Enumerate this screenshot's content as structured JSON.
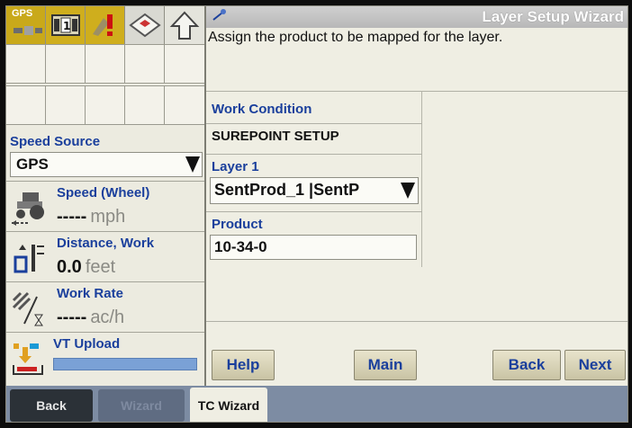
{
  "status_icons": {
    "gps_label": "GPS",
    "channel_number": "1"
  },
  "left_panel": {
    "speed_source_label": "Speed Source",
    "speed_source_value": "GPS",
    "speed": {
      "label": "Speed (Wheel)",
      "value": "-----",
      "unit": "mph"
    },
    "distance": {
      "label": "Distance, Work",
      "value": "0.0",
      "unit": "feet"
    },
    "work_rate": {
      "label": "Work Rate",
      "value": "-----",
      "unit": "ac/h"
    },
    "vt_upload": {
      "label": "VT Upload"
    }
  },
  "wizard": {
    "title": "Layer Setup Wizard",
    "instruction": "Assign the product to be mapped for the layer.",
    "work_condition_label": "Work Condition",
    "work_condition_value": "SUREPOINT SETUP",
    "layer_label": "Layer 1",
    "layer_value": "SentProd_1 |SentP",
    "product_label": "Product",
    "product_value": "10-34-0",
    "buttons": {
      "help": "Help",
      "main": "Main",
      "back": "Back",
      "next": "Next"
    }
  },
  "tabs": {
    "back": "Back",
    "wizard": "Wizard",
    "tc_wizard": "TC Wizard"
  },
  "colors": {
    "label_blue": "#1a3f9c",
    "accent_yellow": "#cfae1d",
    "tab_bar": "#7d8ca3"
  }
}
